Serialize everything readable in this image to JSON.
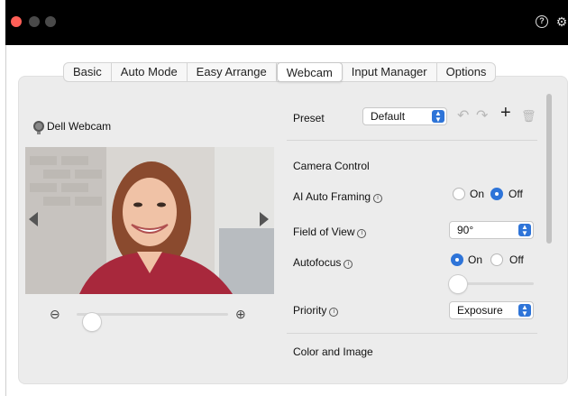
{
  "tabs": [
    "Basic",
    "Auto Mode",
    "Easy Arrange",
    "Webcam",
    "Input Manager",
    "Options"
  ],
  "active_tab": "Webcam",
  "camera": {
    "name": "Dell Webcam"
  },
  "preset": {
    "label": "Preset",
    "value": "Default"
  },
  "sections": {
    "camera_control": "Camera Control",
    "color_image": "Color and Image"
  },
  "ai_framing": {
    "label": "AI Auto Framing",
    "on": "On",
    "off": "Off",
    "selected": "Off"
  },
  "fov": {
    "label": "Field of View",
    "value": "90°"
  },
  "autofocus": {
    "label": "Autofocus",
    "on": "On",
    "off": "Off",
    "selected": "On",
    "focus_level": 0.0
  },
  "priority": {
    "label": "Priority",
    "value": "Exposure"
  },
  "zoom": {
    "level": 0.1
  },
  "icons": {
    "info": "i",
    "help": "?",
    "gear": "⚙",
    "zoom_in": "⊕",
    "zoom_out": "⊖",
    "undo": "↶",
    "redo": "↷",
    "add": "+",
    "trash": "🗑"
  },
  "colors": {
    "accent": "#2e74d8",
    "close": "#ff5f57",
    "titlebar": "#000000"
  }
}
